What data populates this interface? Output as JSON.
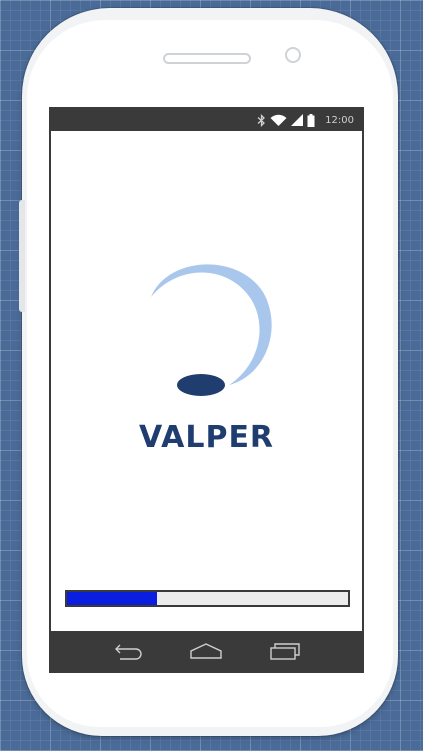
{
  "device": {
    "status_bar": {
      "time": "12:00",
      "icons": [
        "bluetooth-icon",
        "wifi-icon",
        "cell-signal-icon",
        "battery-icon"
      ]
    },
    "nav_bar": {
      "buttons": [
        "back-icon",
        "home-icon",
        "recent-apps-icon"
      ]
    }
  },
  "splash": {
    "brand_name": "VALPER",
    "loading_progress_percent": 32
  },
  "colors": {
    "background": "#4a6b98",
    "brand_dark": "#1f3d6e",
    "brand_light": "#a9c7ec",
    "progress_fill": "#0a1ee0",
    "bars": "#3a3a3a"
  }
}
